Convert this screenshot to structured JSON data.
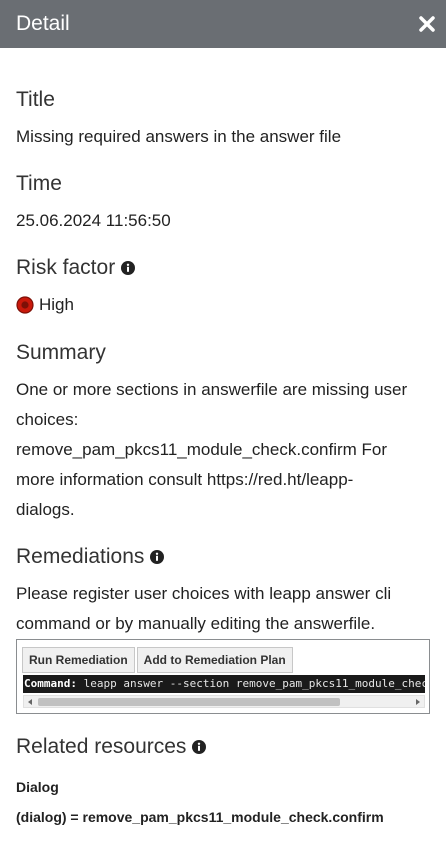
{
  "header": {
    "title": "Detail",
    "close_icon": "close-icon"
  },
  "title_section": {
    "heading": "Title",
    "value": "Missing required answers in the answer file"
  },
  "time_section": {
    "heading": "Time",
    "value": "25.06.2024 11:56:50"
  },
  "risk_section": {
    "heading": "Risk factor",
    "value": "High",
    "color": "#c9190b"
  },
  "summary_section": {
    "heading": "Summary",
    "lines": [
      "One or more sections in answerfile are missing user",
      "choices:",
      "remove_pam_pkcs11_module_check.confirm For",
      "more information consult https://red.ht/leapp-",
      "dialogs."
    ]
  },
  "remediations_section": {
    "heading": "Remediations",
    "lines": [
      "Please register user choices with leapp answer cli",
      "command or by manually editing the answerfile."
    ],
    "run_button": "Run Remediation",
    "add_button": "Add to Remediation Plan",
    "command_label": "Command:",
    "command_text": "leapp answer --section remove_pam_pkcs11_module_chec"
  },
  "related_section": {
    "heading": "Related resources",
    "dialog_label": "Dialog",
    "dialog_value": "(dialog) = remove_pam_pkcs11_module_check.confirm"
  }
}
